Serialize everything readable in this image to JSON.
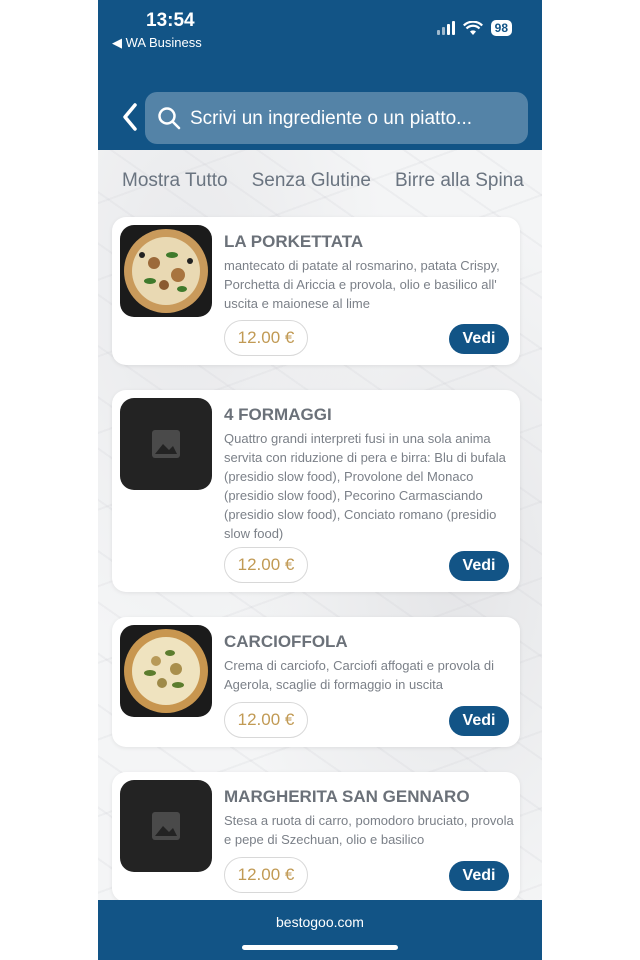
{
  "status": {
    "time": "13:54",
    "back_app": "◀ WA Business",
    "battery": "98"
  },
  "search": {
    "placeholder": "Scrivi un ingrediente o un piatto..."
  },
  "tabs": [
    "Mostra Tutto",
    "Senza Glutine",
    "Birre alla Spina"
  ],
  "items": [
    {
      "title": "LA PORKETTATA",
      "description": "mantecato di patate al rosmarino, patata Crispy, Porchetta di Ariccia e provola, olio e basilico all' uscita e maionese al lime",
      "price": "12.00 €",
      "button": "Vedi",
      "image": "pizza-photo"
    },
    {
      "title": "4 FORMAGGI",
      "description": "Quattro grandi interpreti fusi in una sola anima servita con riduzione di pera e birra: Blu di bufala (presidio slow food), Provolone del Monaco (presidio slow food), Pecorino Carmasciando (presidio slow food), Conciato romano (presidio slow food)",
      "price": "12.00 €",
      "button": "Vedi",
      "image": "placeholder-image-icon"
    },
    {
      "title": "CARCIOFFOLA",
      "description": "Crema di carciofo, Carciofi affogati e provola di Agerola, scaglie di formaggio in uscita",
      "price": "12.00 €",
      "button": "Vedi",
      "image": "pizza-photo"
    },
    {
      "title": "MARGHERITA SAN GENNARO",
      "description": "Stesa a ruota di carro, pomodoro bruciato, provola e pepe di Szechuan, olio e basilico",
      "price": "12.00 €",
      "button": "Vedi",
      "image": "placeholder-image-icon"
    }
  ],
  "footer": {
    "text": "bestogoo.com"
  },
  "colors": {
    "brand_blue": "#125486",
    "price_gold": "#c19a54"
  }
}
